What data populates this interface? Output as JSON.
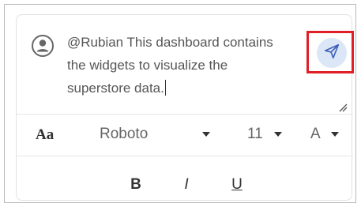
{
  "comment": {
    "text": "@Rubian This dashboard contains the widgets to visualize the superstore data.",
    "line1": "@Rubian This dashboard contains",
    "line2": "the widgets to visualize the",
    "line3": "superstore data."
  },
  "icons": {
    "avatar": "user-avatar-icon",
    "send": "send-icon",
    "resize": "resize-handle-icon",
    "font": "font-format-icon"
  },
  "toolbar": {
    "font_icon_label": "Aa",
    "font_family": "Roboto",
    "font_size": "11",
    "font_color_label": "A"
  },
  "formatting": {
    "bold": "B",
    "italic": "I",
    "underline": "U"
  },
  "colors": {
    "highlight": "#e01f26",
    "send_bg": "#dbe6f7",
    "send_icon": "#3f5fb8"
  }
}
